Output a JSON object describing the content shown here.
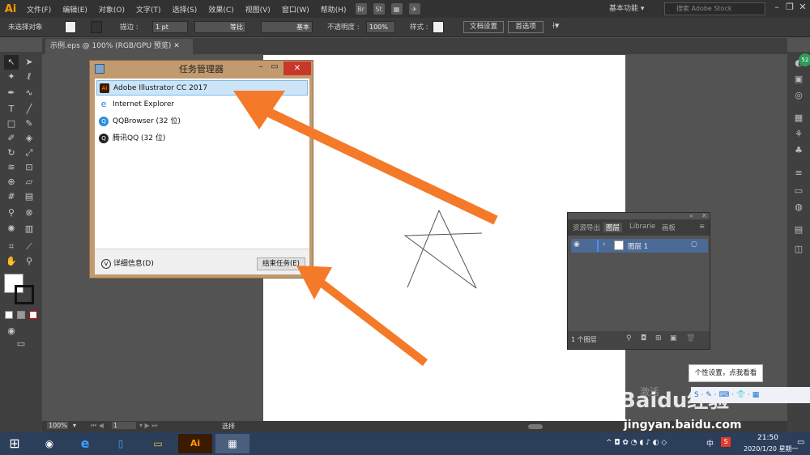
{
  "menubar": {
    "logo": "Ai",
    "items": [
      "文件(F)",
      "编辑(E)",
      "对象(O)",
      "文字(T)",
      "选择(S)",
      "效果(C)",
      "视图(V)",
      "窗口(W)",
      "帮助(H)"
    ],
    "workspace": "基本功能",
    "stock_search_placeholder": "搜索 Adobe Stock"
  },
  "control_bar": {
    "selection": "未选择对象",
    "stroke_label": "描边 :",
    "stroke_value": "1 pt",
    "profile": "等比",
    "brush": "基本",
    "opacity_label": "不透明度 :",
    "opacity_value": "100%",
    "style_label": "样式 :",
    "doc_setup": "文档设置",
    "preferences": "首选项"
  },
  "document_tab": "示例.eps @ 100% (RGB/GPU 预览)",
  "task_manager": {
    "title": "任务管理器",
    "apps": [
      {
        "name": "Adobe Illustrator CC 2017",
        "icon": "illustrator-icon"
      },
      {
        "name": "Internet Explorer",
        "icon": "ie-icon"
      },
      {
        "name": "QQBrowser (32 位)",
        "icon": "qqbrowser-icon"
      },
      {
        "name": "腾讯QQ (32 位)",
        "icon": "qq-icon"
      }
    ],
    "details": "详细信息(D)",
    "end_task": "结束任务(E)"
  },
  "layers_panel": {
    "tabs": [
      "资源导出",
      "图层",
      "Librarie",
      "画板"
    ],
    "layer_name": "图层 1",
    "count": "1 个图层"
  },
  "status_bar": {
    "zoom": "100%",
    "page": "1",
    "tool": "选择"
  },
  "tooltip": "个性设置，点我看看",
  "watermark": {
    "logo": "Baidu经验",
    "url": "jingyan.baidu.com",
    "activate": "激活"
  },
  "taskbar": {
    "time": "21:50",
    "date": "2020/1/20 星期一",
    "ime": "中"
  },
  "colors": {
    "arrow": "#f47a2a",
    "selection": "#cce4f7",
    "layer_row": "#4b6a95"
  }
}
